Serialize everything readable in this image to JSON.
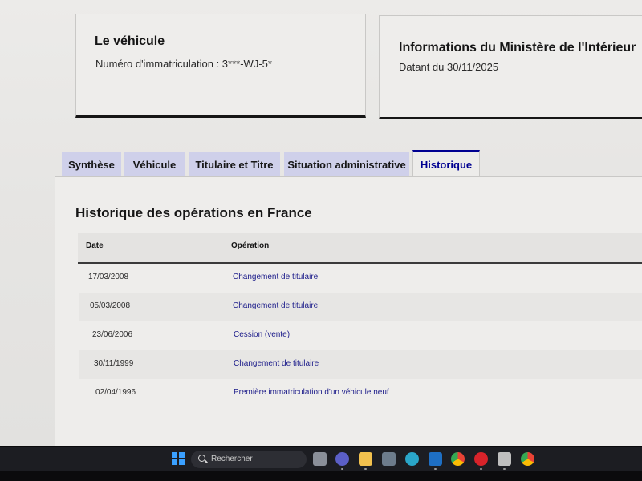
{
  "vehicle_card": {
    "title": "Le véhicule",
    "registration": "Numéro d'immatriculation : 3***-WJ-5*"
  },
  "ministry_card": {
    "title": "Informations du Ministère de l'Intérieur",
    "date": "Datant du 30/11/2025"
  },
  "tabs": [
    {
      "label": "Synthèse",
      "active": false
    },
    {
      "label": "Véhicule",
      "active": false
    },
    {
      "label": "Titulaire et Titre",
      "active": false
    },
    {
      "label": "Situation administrative",
      "active": false
    },
    {
      "label": "Historique",
      "active": true
    }
  ],
  "history": {
    "title": "Historique des opérations en France",
    "columns": {
      "date": "Date",
      "operation": "Opération"
    },
    "rows": [
      {
        "date": "17/03/2008",
        "operation": "Changement de titulaire"
      },
      {
        "date": "05/03/2008",
        "operation": "Changement de titulaire"
      },
      {
        "date": "23/06/2006",
        "operation": "Cession (vente)"
      },
      {
        "date": "30/11/1999",
        "operation": "Changement de titulaire"
      },
      {
        "date": "02/04/1996",
        "operation": "Première immatriculation d'un véhicule neuf"
      }
    ]
  },
  "taskbar": {
    "search_placeholder": "Rechercher",
    "icons": [
      "windows-start-icon",
      "file-manager-icon",
      "teams-icon",
      "file-explorer-icon",
      "store-icon",
      "edge-icon",
      "outlook-icon",
      "chrome-icon",
      "opera-icon",
      "app-icon",
      "chrome-alt-icon"
    ]
  },
  "colors": {
    "accent": "#000091",
    "tab_bg": "#cfd0ea",
    "link": "#1c1c8a"
  }
}
